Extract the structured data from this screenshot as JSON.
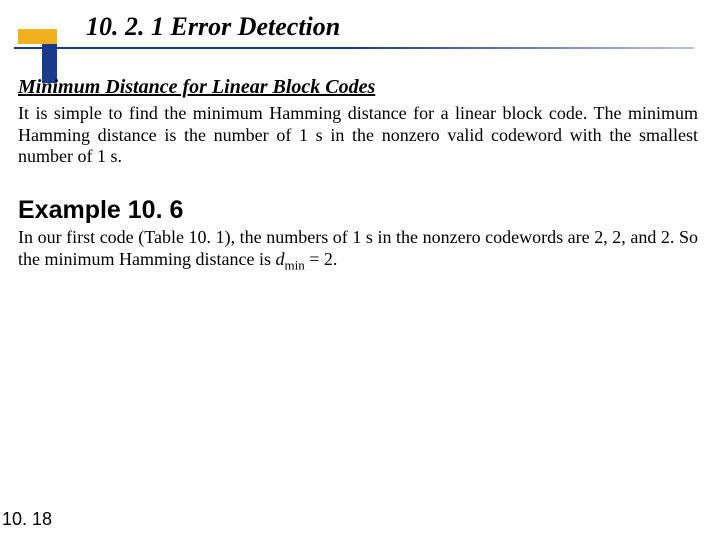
{
  "title": "10. 2. 1 Error Detection",
  "section_heading": "Minimum Distance for Linear Block Codes",
  "body1": "It is simple to find the minimum Hamming distance for a linear block code. The minimum Hamming distance is the number of 1 s in the nonzero valid codeword with the smallest number of 1 s.",
  "example_heading": "Example 10. 6",
  "body2_part1": "In our first code (Table 10. 1), the numbers of 1 s in the nonzero codewords are 2, 2, and 2. So the minimum Hamming distance is ",
  "body2_d": "d",
  "body2_sub": "min",
  "body2_part2": " = 2.",
  "page_number": "10. 18"
}
